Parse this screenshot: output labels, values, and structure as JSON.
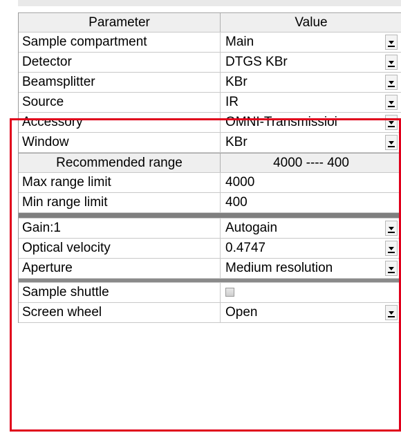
{
  "table": {
    "header": {
      "param": "Parameter",
      "value": "Value"
    },
    "rows_top": [
      {
        "param": "Sample compartment",
        "value": "Main",
        "dropdown": true
      },
      {
        "param": "Detector",
        "value": "DTGS KBr",
        "dropdown": true
      },
      {
        "param": "Beamsplitter",
        "value": "KBr",
        "dropdown": true
      },
      {
        "param": "Source",
        "value": "IR",
        "dropdown": true
      },
      {
        "param": "Accessory",
        "value": "OMNI-Transmissioi",
        "dropdown": true
      },
      {
        "param": "Window",
        "value": "KBr",
        "dropdown": true
      }
    ],
    "recommended": {
      "param": "Recommended range",
      "value": "4000 ---- 400"
    },
    "range_rows": [
      {
        "param": "Max range limit",
        "value": "4000"
      },
      {
        "param": "Min range limit",
        "value": "400"
      }
    ],
    "rows_optics": [
      {
        "param": "Gain:1",
        "value": "Autogain",
        "dropdown": true
      },
      {
        "param": "Optical velocity",
        "value": "0.4747",
        "dropdown": true
      },
      {
        "param": "Aperture",
        "value": "Medium resolution",
        "dropdown": true
      }
    ],
    "rows_bottom": [
      {
        "param": "Sample shuttle",
        "value": "",
        "checkbox": true
      },
      {
        "param": "Screen wheel",
        "value": "Open",
        "dropdown": true
      }
    ]
  },
  "colors": {
    "highlight_border": "#e0001b",
    "header_bg": "#efefef",
    "separator": "#7f7f7f"
  }
}
